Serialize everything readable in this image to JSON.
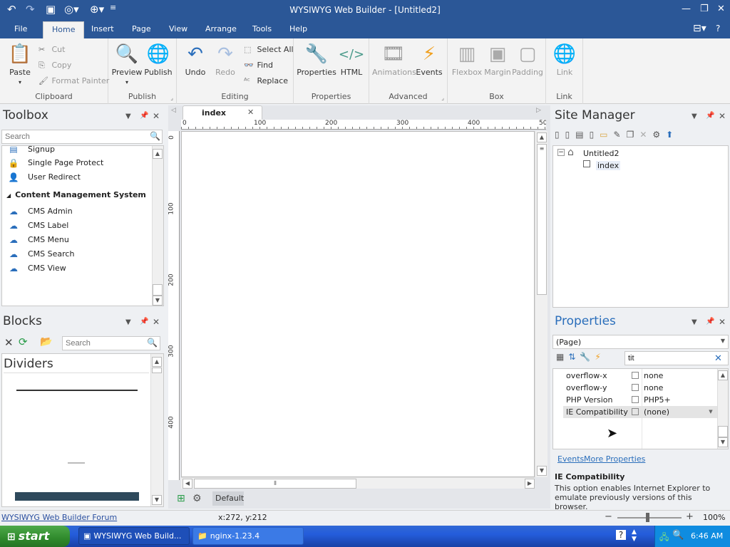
{
  "app": {
    "title": "WYSIWYG Web Builder - [Untitled2]"
  },
  "menu": {
    "file": "File",
    "home": "Home",
    "insert": "Insert",
    "page": "Page",
    "view": "View",
    "arrange": "Arrange",
    "tools": "Tools",
    "help": "Help"
  },
  "ribbon": {
    "clipboard": {
      "paste": "Paste",
      "cut": "Cut",
      "copy": "Copy",
      "format_painter": "Format Painter",
      "label": "Clipboard"
    },
    "publish": {
      "preview": "Preview",
      "publish": "Publish",
      "label": "Publish"
    },
    "editing": {
      "undo": "Undo",
      "redo": "Redo",
      "select_all": "Select All",
      "find": "Find",
      "replace": "Replace",
      "label": "Editing"
    },
    "properties": {
      "properties": "Properties",
      "html": "HTML",
      "label": "Properties"
    },
    "advanced": {
      "animations": "Animations",
      "events": "Events",
      "label": "Advanced"
    },
    "box": {
      "flexbox": "Flexbox",
      "margin": "Margin",
      "padding": "Padding",
      "label": "Box"
    },
    "link": {
      "link": "Link",
      "label": "Link"
    }
  },
  "toolbox": {
    "title": "Toolbox",
    "search_placeholder": "Search",
    "items": [
      {
        "label": "Signup",
        "icon": "signup-icon"
      },
      {
        "label": "Single Page Protect",
        "icon": "lock-icon"
      },
      {
        "label": "User Redirect",
        "icon": "user-icon"
      }
    ],
    "section": "Content Management System",
    "cms_items": [
      {
        "label": "CMS Admin",
        "icon": "cms-admin-icon"
      },
      {
        "label": "CMS Label",
        "icon": "cms-label-icon"
      },
      {
        "label": "CMS Menu",
        "icon": "cms-menu-icon"
      },
      {
        "label": "CMS Search",
        "icon": "cms-search-icon"
      },
      {
        "label": "CMS View",
        "icon": "cms-view-icon"
      }
    ]
  },
  "blocks": {
    "title": "Blocks",
    "search_placeholder": "Search",
    "category": "Dividers"
  },
  "editor": {
    "tab": "index",
    "ruler_top": [
      "0",
      "100",
      "200",
      "300",
      "400",
      "50"
    ],
    "ruler_left": [
      "0",
      "100",
      "200",
      "300",
      "400"
    ],
    "default_label": "Default"
  },
  "site_manager": {
    "title": "Site Manager",
    "root": "Untitled2",
    "page": "index"
  },
  "properties": {
    "title": "Properties",
    "selector": "(Page)",
    "filter": "tit",
    "rows": [
      {
        "name": "overflow-x",
        "value": "none"
      },
      {
        "name": "overflow-y",
        "value": "none"
      },
      {
        "name": "PHP Version",
        "value": "PHP5+"
      },
      {
        "name": "IE Compatibility",
        "value": "(none)"
      }
    ],
    "events_link": "Events",
    "more_link": "More Properties",
    "desc_title": "IE Compatibility",
    "desc_text": "This option enables Internet Explorer to emulate previously versions of this browser."
  },
  "status": {
    "forum": "WYSIWYG Web Builder Forum",
    "coords": "x:272, y:212",
    "zoom": "100%"
  },
  "taskbar": {
    "start": "start",
    "app1": "WYSIWYG Web Build...",
    "app2": "nginx-1.23.4",
    "time": "6:46 AM"
  }
}
